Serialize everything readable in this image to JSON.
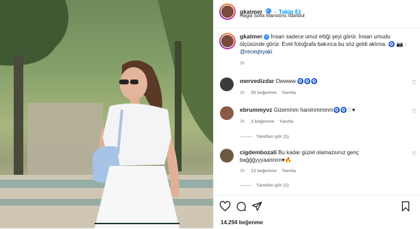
{
  "post": {
    "author": "gkatmer",
    "follow_label": "Takip Et",
    "separator": "•",
    "location": "Hagia Sofia Mansions İstanbul",
    "caption_user": "gkatmer",
    "caption_text": "İnsan sadece umut ettiği şeyi görür. İnsan umudu ölçüsünde görür. Evet fotoğrafa bakınca bu söz geldi aklıma. 🧿 📷 :",
    "caption_mention": "@receqtryaki",
    "caption_time": "3h"
  },
  "comments": [
    {
      "user": "mervedizdar",
      "text": "Owwww 🧿🧿🧿",
      "time": "3h",
      "likes": "50 beğenme",
      "reply": "Yanıtla",
      "avatar_color": "#3b3b3b"
    },
    {
      "user": "ebrummyvz",
      "text": "Gizemmm hanimmmmm🧿🧿♡♥",
      "time": "3h",
      "likes": "3 beğenme",
      "reply": "Yanıtla",
      "view_replies": "Yanıtları gör (1)",
      "avatar_color": "#8a5a44"
    },
    {
      "user": "cigdembozali",
      "text": "Bu kadar güzel olamazsınız genç bağğğyyyaannnn♥🔥",
      "time": "3h",
      "likes": "13 beğenme",
      "reply": "Yanıtla",
      "view_replies": "Yanıtları gör (1)",
      "avatar_color": "#6b5a3e"
    }
  ],
  "footer": {
    "likes_count": "14.294 beğenme"
  },
  "icons": {
    "heart": "heart-icon",
    "comment": "comment-icon",
    "share": "share-icon",
    "save": "bookmark-icon",
    "expand": "expand-icon"
  },
  "colors": {
    "link_blue": "#0095f6",
    "verified_blue": "#3897f0",
    "secondary_text": "#8e8e8e"
  }
}
